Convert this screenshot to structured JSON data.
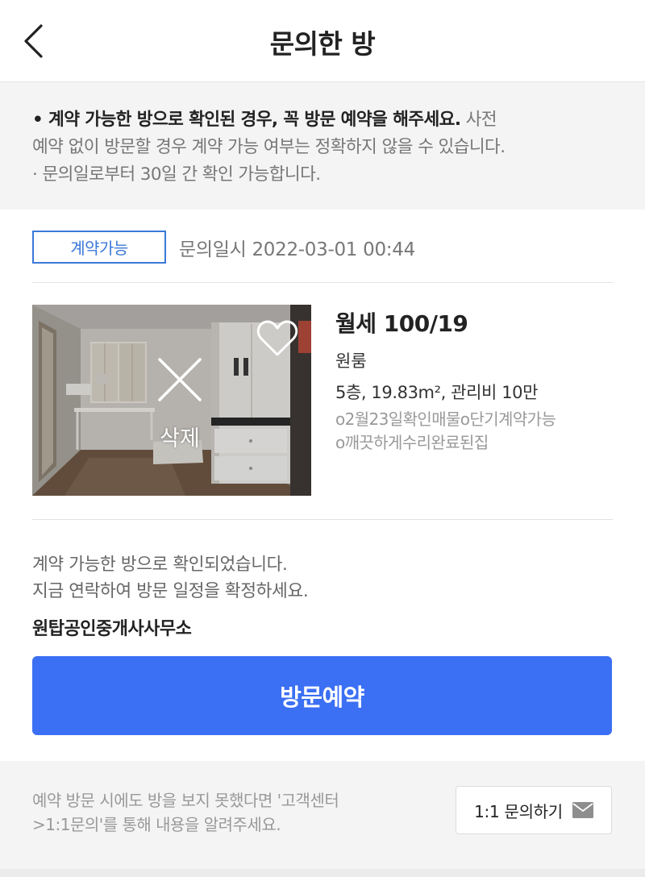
{
  "header": {
    "title": "문의한 방"
  },
  "notice": {
    "line1_bold": "• 계약 가능한 방으로 확인된 경우, 꼭 방문 예약을 해주세요.",
    "line1_rest": " 사전",
    "line2": "예약 없이 방문할 경우 계약 가능 여부는 정확하지 않을 수 있습니다.",
    "line3": "· 문의일로부터 30일 간 확인 가능합니다."
  },
  "status": {
    "badge": "계약가능",
    "inquiry_date": "문의일시 2022-03-01 00:44",
    "badge_color": "#3b78d8"
  },
  "room": {
    "delete_label": "삭제",
    "price": "월세 100/19",
    "type": "원룸",
    "spec": "5층, 19.83m², 관리비 10만",
    "desc_line1": "o2월23일확인매물o단기계약가능",
    "desc_line2": "o깨끗하게수리완료된집"
  },
  "confirm": {
    "line1": "계약 가능한 방으로 확인되었습니다.",
    "line2": "지금 연락하여 방문 일정을 확정하세요."
  },
  "agency": {
    "name": "원탑공인중개사사무소"
  },
  "visit_button": {
    "label": "방문예약",
    "color": "#3b6ff4"
  },
  "footer": {
    "line1": "예약 방문 시에도 방을 보지 못했다면 '고객센터",
    "line2": ">1:1문의'를 통해 내용을 알려주세요.",
    "inquiry_label": "1:1 문의하기"
  },
  "icons": {
    "back": "chevron-left-icon",
    "heart": "heart-icon",
    "delete": "close-icon",
    "mail": "mail-icon"
  }
}
